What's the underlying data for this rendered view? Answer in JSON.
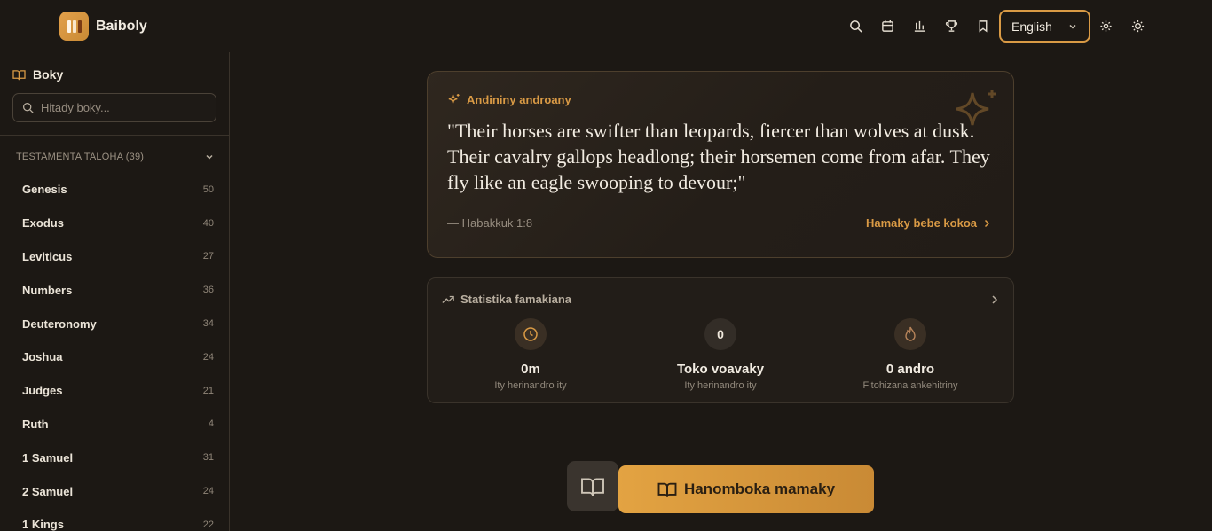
{
  "header": {
    "app_name": "Baiboly",
    "language": "English",
    "icons": [
      "search-icon",
      "calendar-icon",
      "bar-chart-icon",
      "trophy-icon",
      "bookmark-icon",
      "gear-icon",
      "sun-icon"
    ]
  },
  "sidebar": {
    "title": "Boky",
    "search_placeholder": "Hitady boky...",
    "section_label": "TESTAMENTA TALOHA (39)",
    "books": [
      {
        "name": "Genesis",
        "count": "50"
      },
      {
        "name": "Exodus",
        "count": "40"
      },
      {
        "name": "Leviticus",
        "count": "27"
      },
      {
        "name": "Numbers",
        "count": "36"
      },
      {
        "name": "Deuteronomy",
        "count": "34"
      },
      {
        "name": "Joshua",
        "count": "24"
      },
      {
        "name": "Judges",
        "count": "21"
      },
      {
        "name": "Ruth",
        "count": "4"
      },
      {
        "name": "1 Samuel",
        "count": "31"
      },
      {
        "name": "2 Samuel",
        "count": "24"
      },
      {
        "name": "1 Kings",
        "count": "22"
      }
    ]
  },
  "verse": {
    "label": "Andininy androany",
    "text": "\"Their horses are swifter than leopards, fiercer than wolves at dusk. Their cavalry gallops headlong; their horsemen come from afar. They fly like an eagle swooping to devour;\"",
    "reference": "— Habakkuk 1:8",
    "read_more": "Hamaky bebe kokoa"
  },
  "stats": {
    "title": "Statistika famakiana",
    "items": [
      {
        "value": "0m",
        "label": "Ity herinandro ity",
        "icon": "clock-icon"
      },
      {
        "badge": "0",
        "value": "Toko voavaky",
        "label": "Ity herinandro ity"
      },
      {
        "value": "0 andro",
        "label": "Fitohizana ankehitriny",
        "icon": "flame-icon"
      }
    ]
  },
  "actions": {
    "start_reading": "Hanomboka mamaky"
  },
  "colors": {
    "accent": "#d99a45",
    "background": "#1c1814"
  }
}
